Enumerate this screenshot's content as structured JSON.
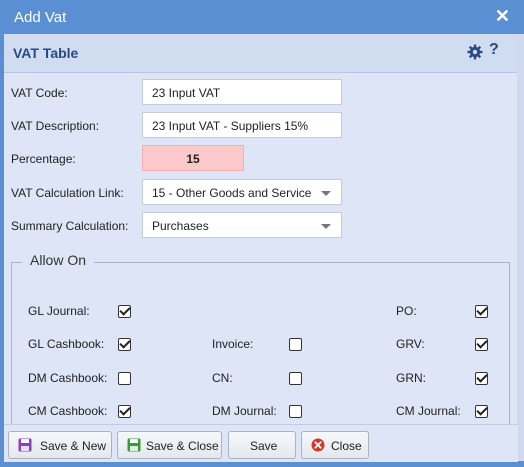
{
  "window": {
    "title": "Add Vat",
    "close_icon": "close-icon"
  },
  "panel": {
    "title": "VAT Table",
    "gear_icon": "gear-icon",
    "help_label": "?"
  },
  "form": {
    "vat_code": {
      "label": "VAT Code:",
      "value": "23 Input VAT"
    },
    "vat_description": {
      "label": "VAT Description:",
      "value": "23 Input VAT - Suppliers 15%"
    },
    "percentage": {
      "label": "Percentage:",
      "value": "15"
    },
    "vat_calculation_link": {
      "label": "VAT Calculation Link:",
      "value": "15 - Other Goods and Service"
    },
    "summary_calculation": {
      "label": "Summary Calculation:",
      "value": "Purchases"
    }
  },
  "allow_on": {
    "legend": "Allow On",
    "items": [
      {
        "label": "GL Journal:",
        "checked": true
      },
      {
        "label": "PO:",
        "checked": true
      },
      {
        "label": "GL Cashbook:",
        "checked": true
      },
      {
        "label": "Invoice:",
        "checked": false
      },
      {
        "label": "GRV:",
        "checked": true
      },
      {
        "label": "DM Cashbook:",
        "checked": false
      },
      {
        "label": "CN:",
        "checked": false
      },
      {
        "label": "GRN:",
        "checked": true
      },
      {
        "label": "CM Cashbook:",
        "checked": true
      },
      {
        "label": "DM Journal:",
        "checked": false
      },
      {
        "label": "CM Journal:",
        "checked": true
      }
    ]
  },
  "footer": {
    "save_new": "Save & New",
    "save_close": "Save & Close",
    "save": "Save",
    "close": "Close"
  },
  "colors": {
    "titlebar": "#5b8fd4",
    "panel": "#dde5f6",
    "percentage_bg": "#fbc9c9",
    "accent_dark": "#2a4a86"
  }
}
